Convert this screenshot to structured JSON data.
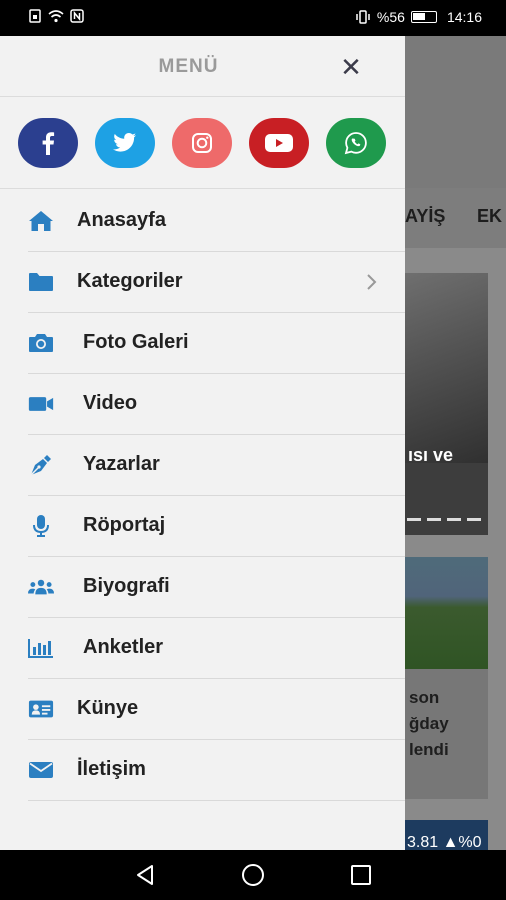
{
  "status_bar": {
    "battery_percent": "%56",
    "time": "14:16",
    "icons_left": [
      "sim-icon",
      "wifi-icon",
      "nfc-icon"
    ],
    "icons_right": [
      "vibrate-icon",
      "battery-icon"
    ]
  },
  "drawer": {
    "title": "MENÜ",
    "close_icon": "close-icon",
    "socials": [
      {
        "name": "facebook",
        "icon": "facebook-icon",
        "color": "#2b3f8f"
      },
      {
        "name": "twitter",
        "icon": "twitter-icon",
        "color": "#1ea1e4"
      },
      {
        "name": "instagram",
        "icon": "instagram-icon",
        "color": "#ee6a6a"
      },
      {
        "name": "youtube",
        "icon": "youtube-icon",
        "color": "#c81f24"
      },
      {
        "name": "whatsapp",
        "icon": "whatsapp-icon",
        "color": "#1f9a4d"
      }
    ],
    "menu_items": [
      {
        "label": "Anasayfa",
        "icon": "home-icon"
      },
      {
        "label": "Kategoriler",
        "icon": "folder-icon",
        "has_submenu": true
      },
      {
        "label": "Foto Galeri",
        "icon": "camera-icon"
      },
      {
        "label": "Video",
        "icon": "video-icon"
      },
      {
        "label": "Yazarlar",
        "icon": "pen-icon"
      },
      {
        "label": "Röportaj",
        "icon": "microphone-icon"
      },
      {
        "label": "Biyografi",
        "icon": "users-icon"
      },
      {
        "label": "Anketler",
        "icon": "chart-icon"
      },
      {
        "label": "Künye",
        "icon": "id-card-icon"
      },
      {
        "label": "İletişim",
        "icon": "envelope-icon"
      }
    ],
    "icon_color": "#2b7fc1"
  },
  "background": {
    "tabs": [
      "AYİŞ",
      "EK"
    ],
    "card1_caption": "ısı ve",
    "card2_caption": "son\nğday\nlendi",
    "card3_text": "3.81 ▲%0"
  },
  "nav_bar": {
    "icons": [
      "back-icon",
      "home-circle-icon",
      "recents-icon"
    ]
  }
}
